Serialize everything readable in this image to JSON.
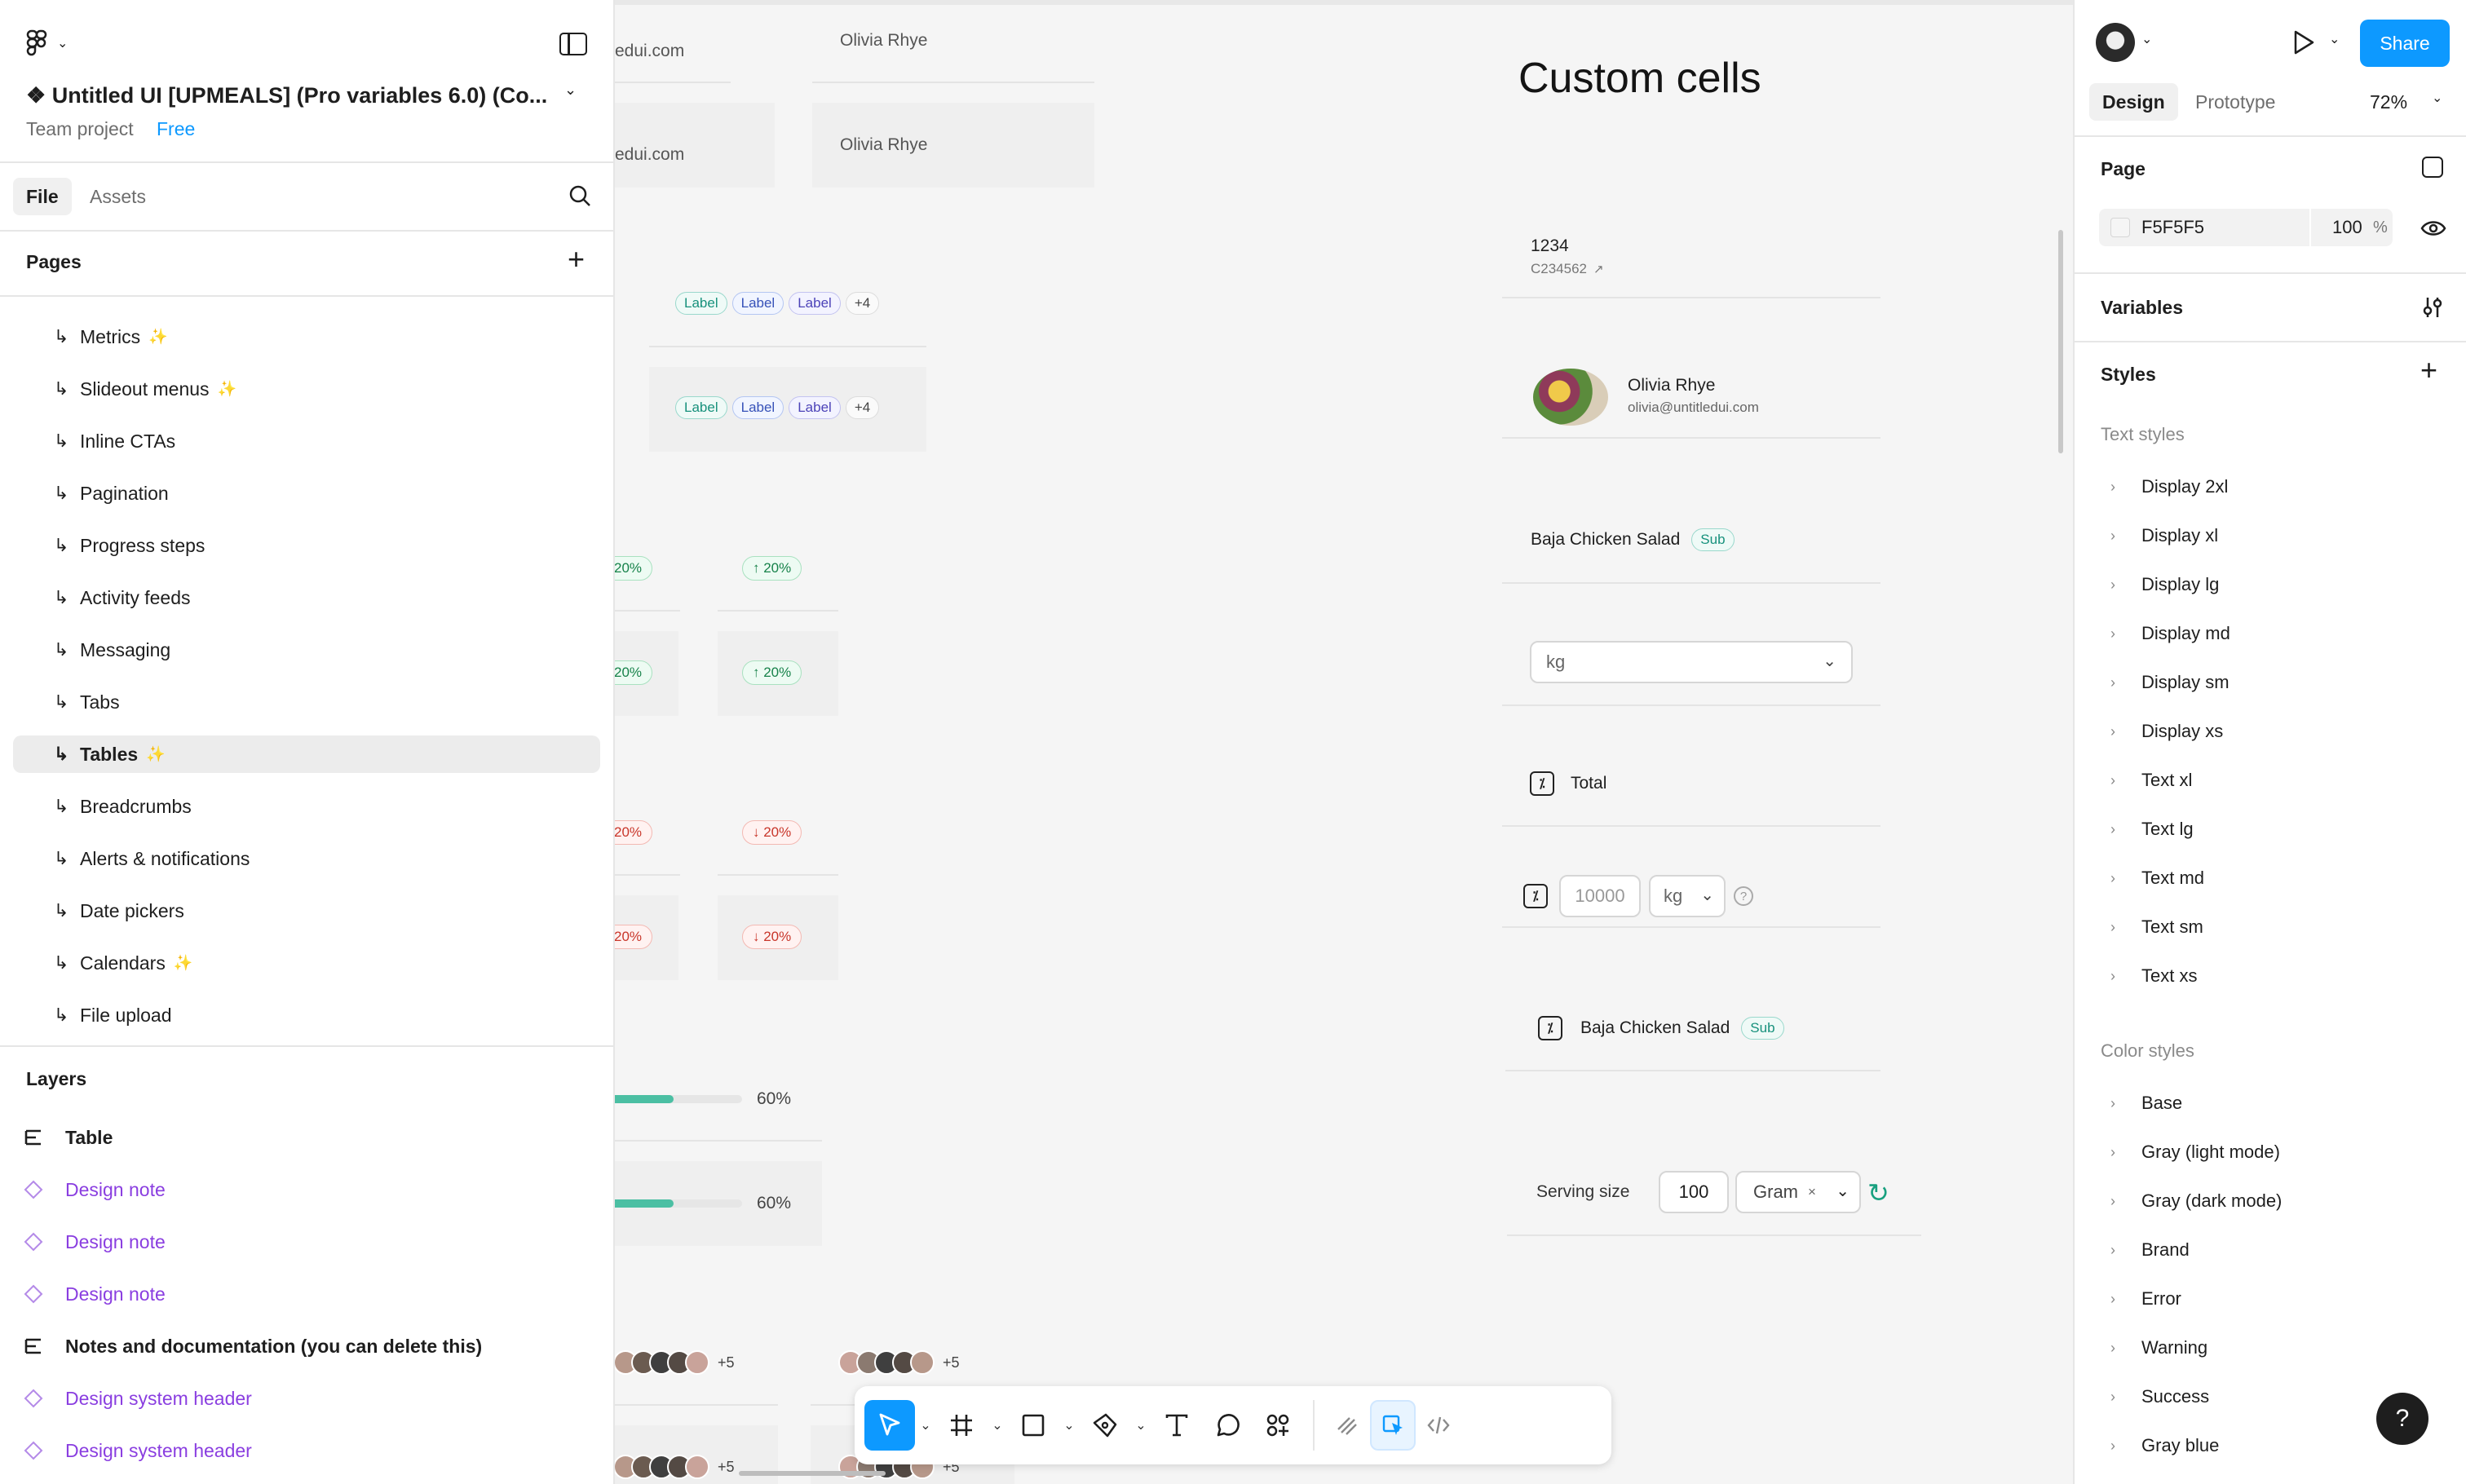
{
  "left_panel": {
    "project_title": "❖ Untitled UI [UPMEALS] (Pro variables 6.0) (Co...",
    "team": "Team project",
    "plan": "Free",
    "tabs": [
      "File",
      "Assets"
    ],
    "pages_header": "Pages",
    "pages": [
      {
        "label": "Metrics",
        "sparkle": true
      },
      {
        "label": "Slideout menus",
        "sparkle": true
      },
      {
        "label": "Inline CTAs",
        "sparkle": false
      },
      {
        "label": "Pagination",
        "sparkle": false
      },
      {
        "label": "Progress steps",
        "sparkle": false
      },
      {
        "label": "Activity feeds",
        "sparkle": false
      },
      {
        "label": "Messaging",
        "sparkle": false
      },
      {
        "label": "Tabs",
        "sparkle": false
      },
      {
        "label": "Tables",
        "sparkle": true,
        "selected": true
      },
      {
        "label": "Breadcrumbs",
        "sparkle": false
      },
      {
        "label": "Alerts & notifications",
        "sparkle": false
      },
      {
        "label": "Date pickers",
        "sparkle": false
      },
      {
        "label": "Calendars",
        "sparkle": true
      },
      {
        "label": "File upload",
        "sparkle": false
      }
    ],
    "arrow_glyph": "↳",
    "layers_header": "Layers",
    "layers": [
      {
        "label": "Table",
        "type": "frame"
      },
      {
        "label": "Design note",
        "type": "instance"
      },
      {
        "label": "Design note",
        "type": "instance"
      },
      {
        "label": "Design note",
        "type": "instance"
      },
      {
        "label": "Notes and documentation (you can delete this)",
        "type": "frame"
      },
      {
        "label": "Design system header",
        "type": "instance"
      },
      {
        "label": "Design system header",
        "type": "instance"
      }
    ]
  },
  "right_panel": {
    "share_label": "Share",
    "tabs": [
      "Design",
      "Prototype"
    ],
    "zoom": "72%",
    "page_section": "Page",
    "page_color": "F5F5F5",
    "page_opacity": "100",
    "percent": "%",
    "variables": "Variables",
    "styles": "Styles",
    "text_styles_header": "Text styles",
    "text_styles": [
      "Display 2xl",
      "Display xl",
      "Display lg",
      "Display md",
      "Display sm",
      "Display xs",
      "Text xl",
      "Text lg",
      "Text md",
      "Text sm",
      "Text xs"
    ],
    "color_styles_header": "Color styles",
    "color_styles": [
      "Base",
      "Gray (light mode)",
      "Gray (dark mode)",
      "Brand",
      "Error",
      "Warning",
      "Success",
      "Gray blue"
    ],
    "help": "?"
  },
  "canvas": {
    "email_fragment": "edui.com",
    "person_name": "Olivia Rhye",
    "chip_labels": [
      "Label",
      "Label",
      "Label",
      "+4"
    ],
    "trend_up": "↑ 20%",
    "trend_down": "↓ 20%",
    "trend_frag": "20%",
    "progress_value": 0.6,
    "progress_label": "60%",
    "avatar_more": "+5",
    "custom_title": "Custom cells",
    "cells": {
      "id_main": "1234",
      "id_sub": "C234562",
      "user_name": "Olivia Rhye",
      "user_email": "olivia@untitledui.com",
      "dish": "Baja Chicken Salad",
      "sub_tag": "Sub",
      "unit_select": "kg",
      "total_label": "Total",
      "amount_placeholder": "10000",
      "unit_small": "kg",
      "serving_label": "Serving size",
      "serving_value": "100",
      "gram_tag": "Gram",
      "help_mark": "?"
    }
  },
  "colors": {
    "accent": "#0d99ff",
    "purple_layer": "#8a3ee0",
    "teal_progress": "#4bbfa3"
  }
}
